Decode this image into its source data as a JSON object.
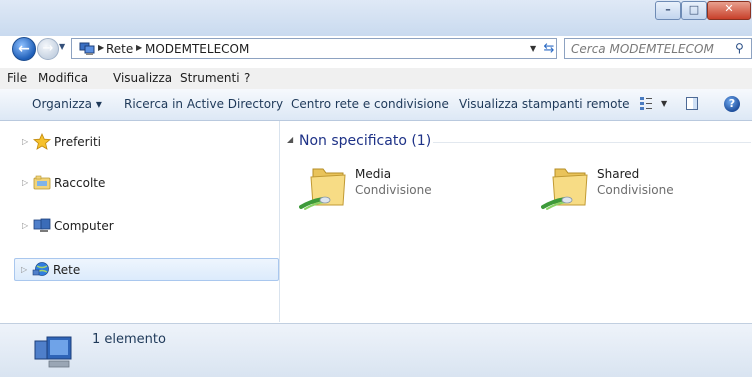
{
  "address": {
    "breadcrumbs": [
      "Rete",
      "MODEMTELECOM"
    ],
    "search_placeholder": "Cerca MODEMTELECOM"
  },
  "menubar": {
    "items": [
      "File",
      "Modifica",
      "Visualizza",
      "Strumenti",
      "?"
    ]
  },
  "commandbar": {
    "organize": "Organizza ▾",
    "search_ad": "Ricerca in Active Directory",
    "network_center": "Centro rete e condivisione",
    "remote_printers": "Visualizza stampanti remote"
  },
  "navpane": {
    "items": [
      {
        "label": "Preferiti",
        "icon": "star-icon"
      },
      {
        "label": "Raccolte",
        "icon": "libraries-icon"
      },
      {
        "label": "Computer",
        "icon": "computer-icon"
      },
      {
        "label": "Rete",
        "icon": "network-icon",
        "selected": true
      }
    ]
  },
  "content": {
    "group_title": "Non specificato (1)",
    "shares": [
      {
        "name": "Media",
        "type": "Condivisione"
      },
      {
        "name": "Shared",
        "type": "Condivisione"
      }
    ]
  },
  "statusbar": {
    "text": "1 elemento"
  },
  "colors": {
    "accent": "#1e3287",
    "selection": "#dcebfc"
  }
}
